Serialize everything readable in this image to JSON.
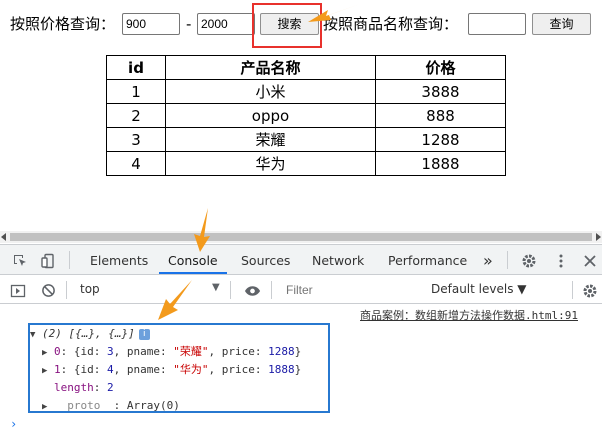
{
  "search": {
    "price_label": "按照价格查询：",
    "min_price": "900",
    "dash": "-",
    "max_price": "2000",
    "search_button": "搜索",
    "name_label": "按照商品名称查询：",
    "name_value": "",
    "query_button": "查询"
  },
  "table": {
    "headers": [
      "id",
      "产品名称",
      "价格"
    ],
    "rows": [
      [
        "1",
        "小米",
        "3888"
      ],
      [
        "2",
        "oppo",
        "888"
      ],
      [
        "3",
        "荣耀",
        "1288"
      ],
      [
        "4",
        "华为",
        "1888"
      ]
    ]
  },
  "devtools": {
    "tabs": [
      "Elements",
      "Console",
      "Sources",
      "Network",
      "Performance"
    ],
    "active_tab": "Console",
    "more_tabs": "»",
    "context": "top",
    "filter_placeholder": "Filter",
    "levels": "Default levels ▼",
    "source_link": "商品案例：数组新增方法操作数据.html:91",
    "log": {
      "summary": "(2) [{…}, {…}]",
      "items": [
        {
          "index": "0",
          "id": "3",
          "pname": "荣耀",
          "price": "1288"
        },
        {
          "index": "1",
          "id": "4",
          "pname": "华为",
          "price": "1888"
        }
      ],
      "length_label": "length",
      "length_value": "2",
      "proto_label": "__proto__",
      "proto_value": "Array(0)"
    },
    "prompt": "›"
  },
  "colors": {
    "highlight_red": "#e8312c",
    "arrow_orange": "#f39a1c",
    "log_box_blue": "#2778d0",
    "active_tab_blue": "#1a73e8"
  }
}
